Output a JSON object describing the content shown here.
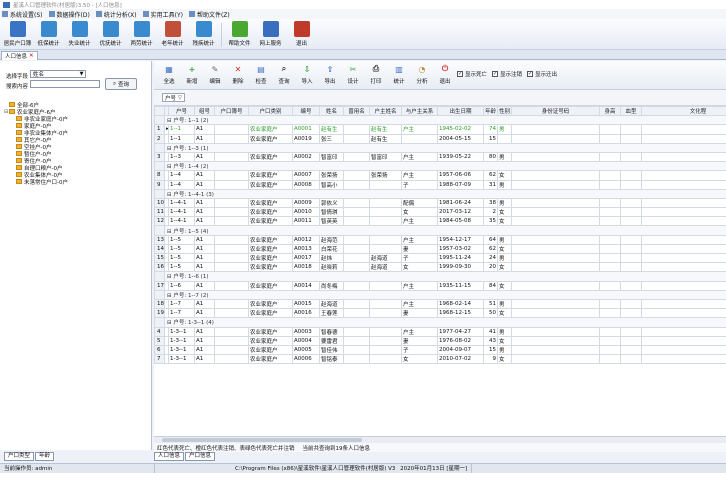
{
  "window": {
    "title": "星溪人口管理软件(村居版)3.50 - [人口信息]"
  },
  "menu": [
    {
      "label": "系统设置(S)",
      "icon": "settings-icon"
    },
    {
      "label": "数据操作(D)",
      "icon": "database-icon"
    },
    {
      "label": "统计分析(X)",
      "icon": "chart-icon"
    },
    {
      "label": "实用工具(Y)",
      "icon": "tools-icon"
    },
    {
      "label": "帮助文件(Z)",
      "icon": "help-icon"
    }
  ],
  "toolbar": [
    {
      "label": "居民户口簿",
      "icon": "household-book-icon",
      "color": "#3b74c4"
    },
    {
      "label": "低保统计",
      "icon": "low-income-icon",
      "color": "#3a8ad0"
    },
    {
      "label": "失业统计",
      "icon": "unemployed-icon",
      "color": "#3a8ad0"
    },
    {
      "label": "优抚统计",
      "icon": "veteran-icon",
      "color": "#3a8ad0"
    },
    {
      "label": "两劳统计",
      "icon": "labor-icon",
      "color": "#3a8ad0"
    },
    {
      "label": "老年统计",
      "icon": "elderly-icon",
      "color": "#c0503a"
    },
    {
      "label": "残疾统计",
      "icon": "disabled-icon",
      "color": "#3a8ad0"
    },
    {
      "label": "帮助文件",
      "icon": "help-file-icon",
      "color": "#4aa832"
    },
    {
      "label": "网上服务",
      "icon": "online-service-icon",
      "color": "#3a6fc0"
    },
    {
      "label": "退出",
      "icon": "exit-icon",
      "color": "#c03a2a"
    }
  ],
  "doc_tab": {
    "label": "人口信息"
  },
  "left_panel": {
    "filter_label": "选择字段",
    "filter_value": "姓名",
    "search_label": "搜索内容",
    "search_value": "",
    "search_button": "查询",
    "tree": [
      {
        "label": "全部-6户",
        "level": 0,
        "expander": ""
      },
      {
        "label": "农业家庭户-6户",
        "level": 0,
        "expander": "⊟"
      },
      {
        "label": "非农业家庭户-0户",
        "level": 1,
        "expander": ""
      },
      {
        "label": "家庭户-0户",
        "level": 1,
        "expander": ""
      },
      {
        "label": "非农业集体户-0户",
        "level": 1,
        "expander": ""
      },
      {
        "label": "其它户-0户",
        "level": 1,
        "expander": ""
      },
      {
        "label": "空挂户-0户",
        "level": 1,
        "expander": ""
      },
      {
        "label": "暂住户-0户",
        "level": 1,
        "expander": ""
      },
      {
        "label": "寄住户-0户",
        "level": 1,
        "expander": ""
      },
      {
        "label": "自理口粮户-0户",
        "level": 1,
        "expander": ""
      },
      {
        "label": "农业集体户-0户",
        "level": 1,
        "expander": ""
      },
      {
        "label": "未落常住户口-0户",
        "level": 1,
        "expander": ""
      }
    ],
    "tabs": [
      "户口类型",
      "年龄"
    ]
  },
  "record_toolbar": [
    {
      "label": "全选",
      "icon": "select-all-icon",
      "color": "#3a6fc0",
      "glyph": "▦"
    },
    {
      "label": "新增",
      "icon": "add-icon",
      "color": "#3aa83a",
      "glyph": "+"
    },
    {
      "label": "编辑",
      "icon": "edit-icon",
      "color": "#6a6a6a",
      "glyph": "✎"
    },
    {
      "label": "删除",
      "icon": "delete-icon",
      "color": "#d03030",
      "glyph": "✕"
    },
    {
      "label": "检查",
      "icon": "check-icon",
      "color": "#3a6fc0",
      "glyph": "▤"
    },
    {
      "label": "查询",
      "icon": "query-icon",
      "color": "#444",
      "glyph": "⌕"
    },
    {
      "label": "导入",
      "icon": "import-icon",
      "color": "#3aa83a",
      "glyph": "⇩"
    },
    {
      "label": "导出",
      "icon": "export-icon",
      "color": "#3a6fc0",
      "glyph": "⇧"
    },
    {
      "label": "设计",
      "icon": "design-icon",
      "color": "#3aa83a",
      "glyph": "✂"
    },
    {
      "label": "打印",
      "icon": "print-icon",
      "color": "#444",
      "glyph": "⎙"
    },
    {
      "label": "统计",
      "icon": "statistics-icon",
      "color": "#3a6fc0",
      "glyph": "▥"
    },
    {
      "label": "分析",
      "icon": "analysis-icon",
      "color": "#c08a3a",
      "glyph": "◔"
    },
    {
      "label": "退出",
      "icon": "exit-icon",
      "color": "#d03030",
      "glyph": "⏻"
    }
  ],
  "options": [
    {
      "label": "显示死亡",
      "checked": true
    },
    {
      "label": "显示注销",
      "checked": true
    },
    {
      "label": "显示迁出",
      "checked": true
    }
  ],
  "group_by": "户号",
  "columns": [
    "户号",
    "组号",
    "户口簿号",
    "户口类别",
    "编号",
    "姓名",
    "曾用名",
    "户主姓名",
    "与户主关系",
    "出生日期",
    "年龄",
    "性别",
    "身份证号码",
    "身高",
    "血型",
    "文化程"
  ],
  "rows": [
    {
      "type": "group",
      "label": "户号: 1--1 (2)"
    },
    {
      "type": "data",
      "rn": "1",
      "cur": true,
      "cells": [
        "1--1",
        "A1",
        "",
        "农业家庭户",
        "A0001",
        "赵有生",
        "",
        "赵有生",
        "户主",
        "1945-02-02",
        "74",
        "男",
        "",
        "",
        "",
        ""
      ],
      "green": true
    },
    {
      "type": "data",
      "rn": "2",
      "cells": [
        "1--1",
        "A1",
        "",
        "农业家庭户",
        "A0019",
        "张三",
        "",
        "赵有生",
        "",
        "2004-05-15",
        "15",
        "",
        "",
        "",
        "",
        ""
      ]
    },
    {
      "type": "group",
      "label": "户号: 1--3 (1)"
    },
    {
      "type": "data",
      "rn": "3",
      "cells": [
        "1--3",
        "A1",
        "",
        "农业家庭户",
        "A0002",
        "智富印",
        "",
        "智富印",
        "户主",
        "1939-05-22",
        "80",
        "男",
        "",
        "",
        "",
        ""
      ]
    },
    {
      "type": "group",
      "label": "户号: 1--4 (2)"
    },
    {
      "type": "data",
      "rn": "8",
      "cells": [
        "1--4",
        "A1",
        "",
        "农业家庭户",
        "A0007",
        "张荣扬",
        "",
        "张荣扬",
        "户主",
        "1957-06-06",
        "62",
        "女",
        "",
        "",
        "",
        ""
      ]
    },
    {
      "type": "data",
      "rn": "9",
      "cells": [
        "1--4",
        "A1",
        "",
        "农业家庭户",
        "A0008",
        "智高小",
        "",
        "",
        "子",
        "1988-07-09",
        "31",
        "男",
        "",
        "",
        "",
        ""
      ]
    },
    {
      "type": "group",
      "label": "户号: 1--4-1 (3)"
    },
    {
      "type": "data",
      "rn": "10",
      "cells": [
        "1--4-1",
        "A1",
        "",
        "农业家庭户",
        "A0009",
        "郭依义",
        "",
        "",
        "配偶",
        "1981-06-24",
        "38",
        "男",
        "",
        "",
        "",
        ""
      ]
    },
    {
      "type": "data",
      "rn": "11",
      "cells": [
        "1--4-1",
        "A1",
        "",
        "农业家庭户",
        "A0010",
        "智倩琪",
        "",
        "",
        "女",
        "2017-03-12",
        "2",
        "女",
        "",
        "",
        "",
        ""
      ]
    },
    {
      "type": "data",
      "rn": "12",
      "cells": [
        "1--4-1",
        "A1",
        "",
        "农业家庭户",
        "A0011",
        "智英英",
        "",
        "",
        "户主",
        "1984-05-08",
        "35",
        "女",
        "",
        "",
        "",
        ""
      ]
    },
    {
      "type": "group",
      "label": "户号: 1--5 (4)"
    },
    {
      "type": "data",
      "rn": "13",
      "cells": [
        "1--5",
        "A1",
        "",
        "农业家庭户",
        "A0012",
        "赵海范",
        "",
        "",
        "户主",
        "1954-12-17",
        "64",
        "男",
        "",
        "",
        "",
        ""
      ]
    },
    {
      "type": "data",
      "rn": "14",
      "cells": [
        "1--5",
        "A1",
        "",
        "农业家庭户",
        "A0013",
        "白荣花",
        "",
        "",
        "妻",
        "1957-03-02",
        "62",
        "女",
        "",
        "",
        "",
        ""
      ]
    },
    {
      "type": "data",
      "rn": "15",
      "cells": [
        "1--5",
        "A1",
        "",
        "农业家庭户",
        "A0017",
        "赵炜",
        "",
        "赵海道",
        "子",
        "1995-11-24",
        "24",
        "男",
        "",
        "",
        "",
        ""
      ]
    },
    {
      "type": "data",
      "rn": "16",
      "cells": [
        "1--5",
        "A1",
        "",
        "农业家庭户",
        "A0018",
        "赵晓莉",
        "",
        "赵海道",
        "女",
        "1999-09-30",
        "20",
        "女",
        "",
        "",
        "",
        ""
      ]
    },
    {
      "type": "group",
      "label": "户号: 1--6 (1)"
    },
    {
      "type": "data",
      "rn": "17",
      "cells": [
        "1--6",
        "A1",
        "",
        "农业家庭户",
        "A0014",
        "尚冬梅",
        "",
        "",
        "户主",
        "1935-11-15",
        "84",
        "女",
        "",
        "",
        "",
        ""
      ]
    },
    {
      "type": "group",
      "label": "户号: 1--7 (2)"
    },
    {
      "type": "data",
      "rn": "18",
      "cells": [
        "1--7",
        "A1",
        "",
        "农业家庭户",
        "A0015",
        "赵海道",
        "",
        "",
        "户主",
        "1968-02-14",
        "51",
        "男",
        "",
        "",
        "",
        ""
      ]
    },
    {
      "type": "data",
      "rn": "19",
      "cells": [
        "1--7",
        "A1",
        "",
        "农业家庭户",
        "A0016",
        "王春莲",
        "",
        "",
        "妻",
        "1968-12-15",
        "50",
        "女",
        "",
        "",
        "",
        ""
      ]
    },
    {
      "type": "group",
      "label": "户号: 1-3--1 (4)"
    },
    {
      "type": "data",
      "rn": "4",
      "cells": [
        "1-3--1",
        "A1",
        "",
        "农业家庭户",
        "A0003",
        "智春德",
        "",
        "",
        "户主",
        "1977-04-27",
        "41",
        "男",
        "",
        "",
        "",
        ""
      ]
    },
    {
      "type": "data",
      "rn": "5",
      "cells": [
        "1-3--1",
        "A1",
        "",
        "农业家庭户",
        "A0004",
        "要雷君",
        "",
        "",
        "妻",
        "1976-08-02",
        "43",
        "女",
        "",
        "",
        "",
        ""
      ]
    },
    {
      "type": "data",
      "rn": "6",
      "cells": [
        "1-3--1",
        "A1",
        "",
        "农业家庭户",
        "A0005",
        "智佳伟",
        "",
        "",
        "子",
        "2004-09-07",
        "15",
        "男",
        "",
        "",
        "",
        ""
      ]
    },
    {
      "type": "data",
      "rn": "7",
      "cells": [
        "1-3--1",
        "A1",
        "",
        "农业家庭户",
        "A0006",
        "智铭泰",
        "",
        "",
        "女",
        "2010-07-02",
        "9",
        "女",
        "",
        "",
        "",
        ""
      ]
    }
  ],
  "legend": "红色代表死亡、橙红色代表注销、表绿色代表死亡并注销",
  "record_info": "当前共查询到19条人口信息",
  "bottom_tabs": [
    "人口信息",
    "户口信息"
  ],
  "status": {
    "operator": "当前操作员: admin",
    "path": "C:\\Program Files (x86)\\星溪软件\\星溪人口管理软件(村居版) V3",
    "date": "2020年01月13日 [星期一]"
  }
}
